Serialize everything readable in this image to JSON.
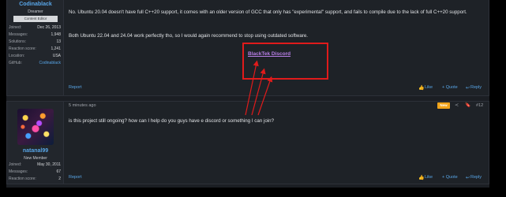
{
  "post1": {
    "author": {
      "name": "Codinablack",
      "title": "Dreamer",
      "banner": "Content Editor",
      "stats": [
        {
          "k": "Joined:",
          "v": "Dec 26, 2013"
        },
        {
          "k": "Messages:",
          "v": "1,948"
        },
        {
          "k": "Solutions:",
          "v": "13"
        },
        {
          "k": "Reaction score:",
          "v": "1,241"
        },
        {
          "k": "Location:",
          "v": "USA"
        },
        {
          "k": "GitHub:",
          "v": "Codinablack"
        }
      ]
    },
    "paragraph1": "No. Ubuntu 20.04 doesn't have full C++20 support, it comes with an older version of GCC that only has \"experimental\" support, and fails to compile due to the lack of full C++20 support.",
    "paragraph2": "Both Ubuntu 22.04 and 24.04 work perfectly tho, so I would again recommend to stop using outdated software.",
    "discord_link": "BlackTek Discord",
    "report": "Report",
    "like": "Like",
    "quote": "+ Quote",
    "reply": "Reply"
  },
  "post2": {
    "time": "5 minutes ago",
    "new_badge": "New",
    "post_number": "#12",
    "author": {
      "name": "natanal99",
      "title": "New Member",
      "stats": [
        {
          "k": "Joined:",
          "v": "May 30, 2011"
        },
        {
          "k": "Messages:",
          "v": "67"
        },
        {
          "k": "Reaction score:",
          "v": "2"
        }
      ]
    },
    "message": "is this project still ongoing? how can I help do you guys have e discord or something I can join?",
    "report": "Report",
    "like": "Like",
    "quote": "+ Quote",
    "reply": "Reply"
  },
  "colors": {
    "link": "#58a6e8",
    "discord_link": "#b77ee6",
    "annotation": "#e01b1b",
    "new_badge": "#f0a31a"
  },
  "icons": [
    "thumbs-up-icon",
    "reply-arrow-icon",
    "share-icon",
    "bookmark-icon"
  ]
}
